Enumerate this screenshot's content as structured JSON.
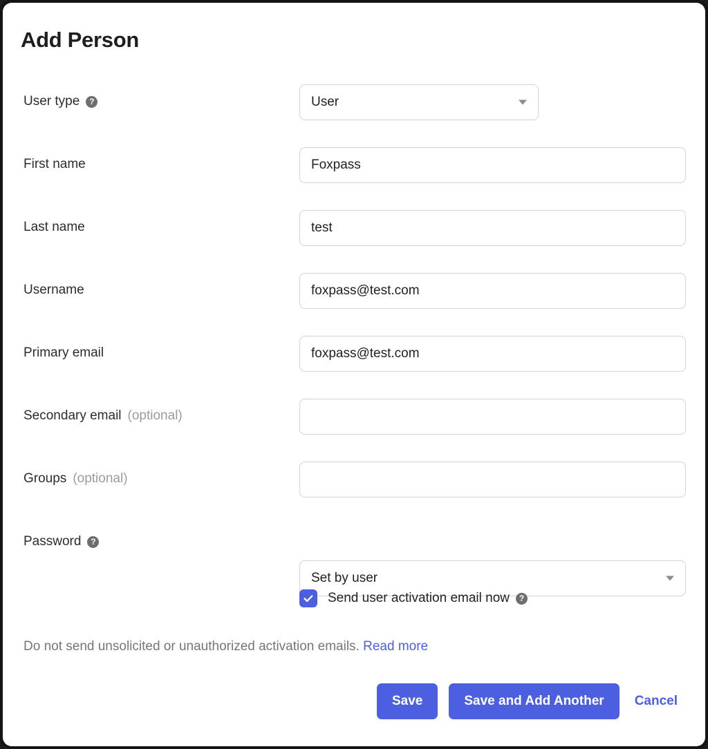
{
  "dialog": {
    "title": "Add Person"
  },
  "fields": [
    {
      "label": "User type",
      "optional_suffix": "",
      "help_icon": "help-circle-icon",
      "control": "select",
      "width": "narrow",
      "value": "User",
      "placeholder": "",
      "name": "user-type"
    },
    {
      "label": "First name",
      "optional_suffix": "",
      "help_icon": "",
      "control": "text",
      "width": "wide",
      "value": "Foxpass",
      "placeholder": "",
      "name": "first-name"
    },
    {
      "label": "Last name",
      "optional_suffix": "",
      "help_icon": "",
      "control": "text",
      "width": "wide",
      "value": "test",
      "placeholder": "",
      "name": "last-name"
    },
    {
      "label": "Username",
      "optional_suffix": "",
      "help_icon": "",
      "control": "text",
      "width": "wide",
      "value": "foxpass@test.com",
      "placeholder": "",
      "name": "username"
    },
    {
      "label": "Primary email",
      "optional_suffix": "",
      "help_icon": "",
      "control": "text",
      "width": "wide",
      "value": "foxpass@test.com",
      "placeholder": "",
      "name": "primary-email"
    },
    {
      "label": "Secondary email",
      "optional_suffix": "(optional)",
      "help_icon": "",
      "control": "text",
      "width": "wide",
      "value": "",
      "placeholder": "",
      "name": "secondary-email"
    },
    {
      "label": "Groups",
      "optional_suffix": "(optional)",
      "help_icon": "",
      "control": "text",
      "width": "wide",
      "value": "",
      "placeholder": "",
      "name": "groups"
    },
    {
      "label": "Password",
      "optional_suffix": "",
      "help_icon": "help-circle-icon",
      "control": "select",
      "width": "wide",
      "value": "Set by user",
      "placeholder": "",
      "name": "password"
    }
  ],
  "activation": {
    "checked": true,
    "label": "Send user activation email now",
    "help_icon": "help-circle-icon",
    "help_glyph": "?"
  },
  "notice": {
    "text": "Do not send unsolicited or unauthorized activation emails.",
    "link_label": "Read more"
  },
  "actions": {
    "save_label": "Save",
    "save_add_another_label": "Save and Add Another",
    "cancel_label": "Cancel"
  },
  "colors": {
    "accent": "#4b5fe0",
    "label_text": "#2c2c2c",
    "muted_text": "#9b9b9b",
    "notice_text": "#767676",
    "field_border": "#d3d3d3",
    "help_icon_bg": "#6e6e6e"
  },
  "glyphs": {
    "help": "?"
  }
}
